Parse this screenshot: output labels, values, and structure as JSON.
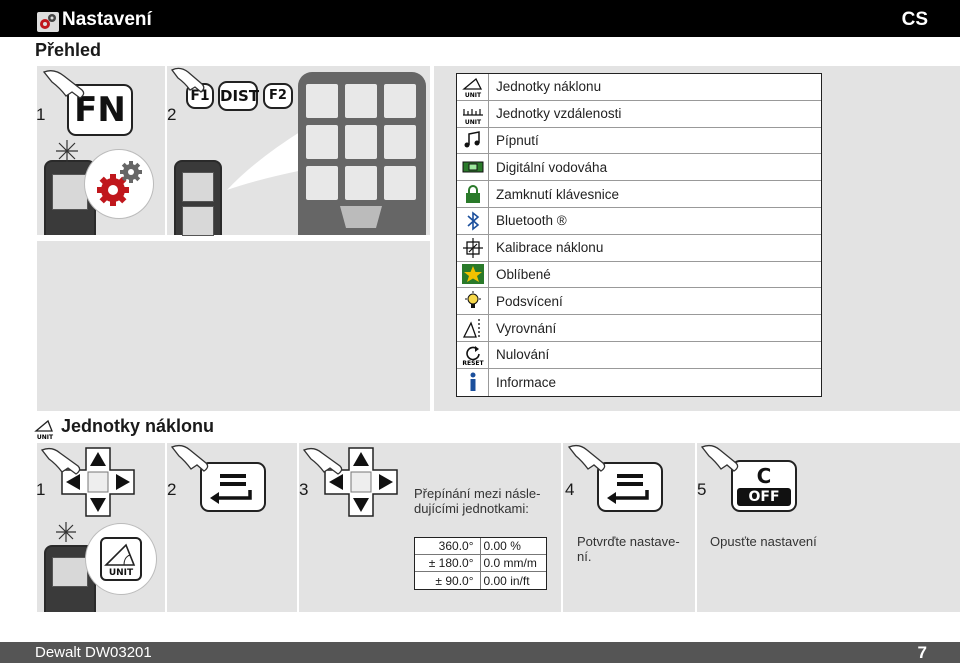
{
  "header": {
    "title": "Nastavení",
    "lang": "CS"
  },
  "overview": {
    "heading": "Přehled",
    "steps": [
      "1",
      "2"
    ],
    "fn_key": "FN",
    "f1_key": "F1",
    "dist_key": "DIST",
    "f2_key": "F2"
  },
  "menu": {
    "items": [
      {
        "icon": "angle-unit-icon",
        "label": "Jednotky náklonu"
      },
      {
        "icon": "distance-unit-icon",
        "label": "Jednotky vzdálenosti"
      },
      {
        "icon": "music-note-icon",
        "label": "Pípnutí"
      },
      {
        "icon": "level-icon",
        "label": "Digitální vodováha"
      },
      {
        "icon": "lock-icon",
        "label": "Zamknutí klávesnice"
      },
      {
        "icon": "bluetooth-icon",
        "label": "Bluetooth ®"
      },
      {
        "icon": "tilt-calibration-icon",
        "label": "Kalibrace náklonu"
      },
      {
        "icon": "star-icon",
        "label": "Oblíbené"
      },
      {
        "icon": "bulb-icon",
        "label": "Podsvícení"
      },
      {
        "icon": "alignment-icon",
        "label": "Vyrovnání"
      },
      {
        "icon": "reset-icon",
        "label": "Nulování"
      },
      {
        "icon": "info-icon",
        "label": "Informace"
      }
    ]
  },
  "tilt_units": {
    "heading": "Jednotky náklonu",
    "steps": [
      "1",
      "2",
      "3",
      "4",
      "5"
    ],
    "unit_label": "UNIT",
    "toggle_text": "Přepínání mezi násle-dujícími jednotkami:",
    "table": [
      [
        "360.0°",
        "0.00 %"
      ],
      [
        "± 180.0°",
        "0.0 mm/m"
      ],
      [
        "± 90.0°",
        "0.00 in/ft"
      ]
    ],
    "confirm_text": "Potvrďte nastave-ní.",
    "exit_text": "Opusťte nastavení",
    "c_key": "C",
    "off_key": "OFF"
  },
  "footer": {
    "model": "Dewalt DW03201",
    "page": "7"
  }
}
